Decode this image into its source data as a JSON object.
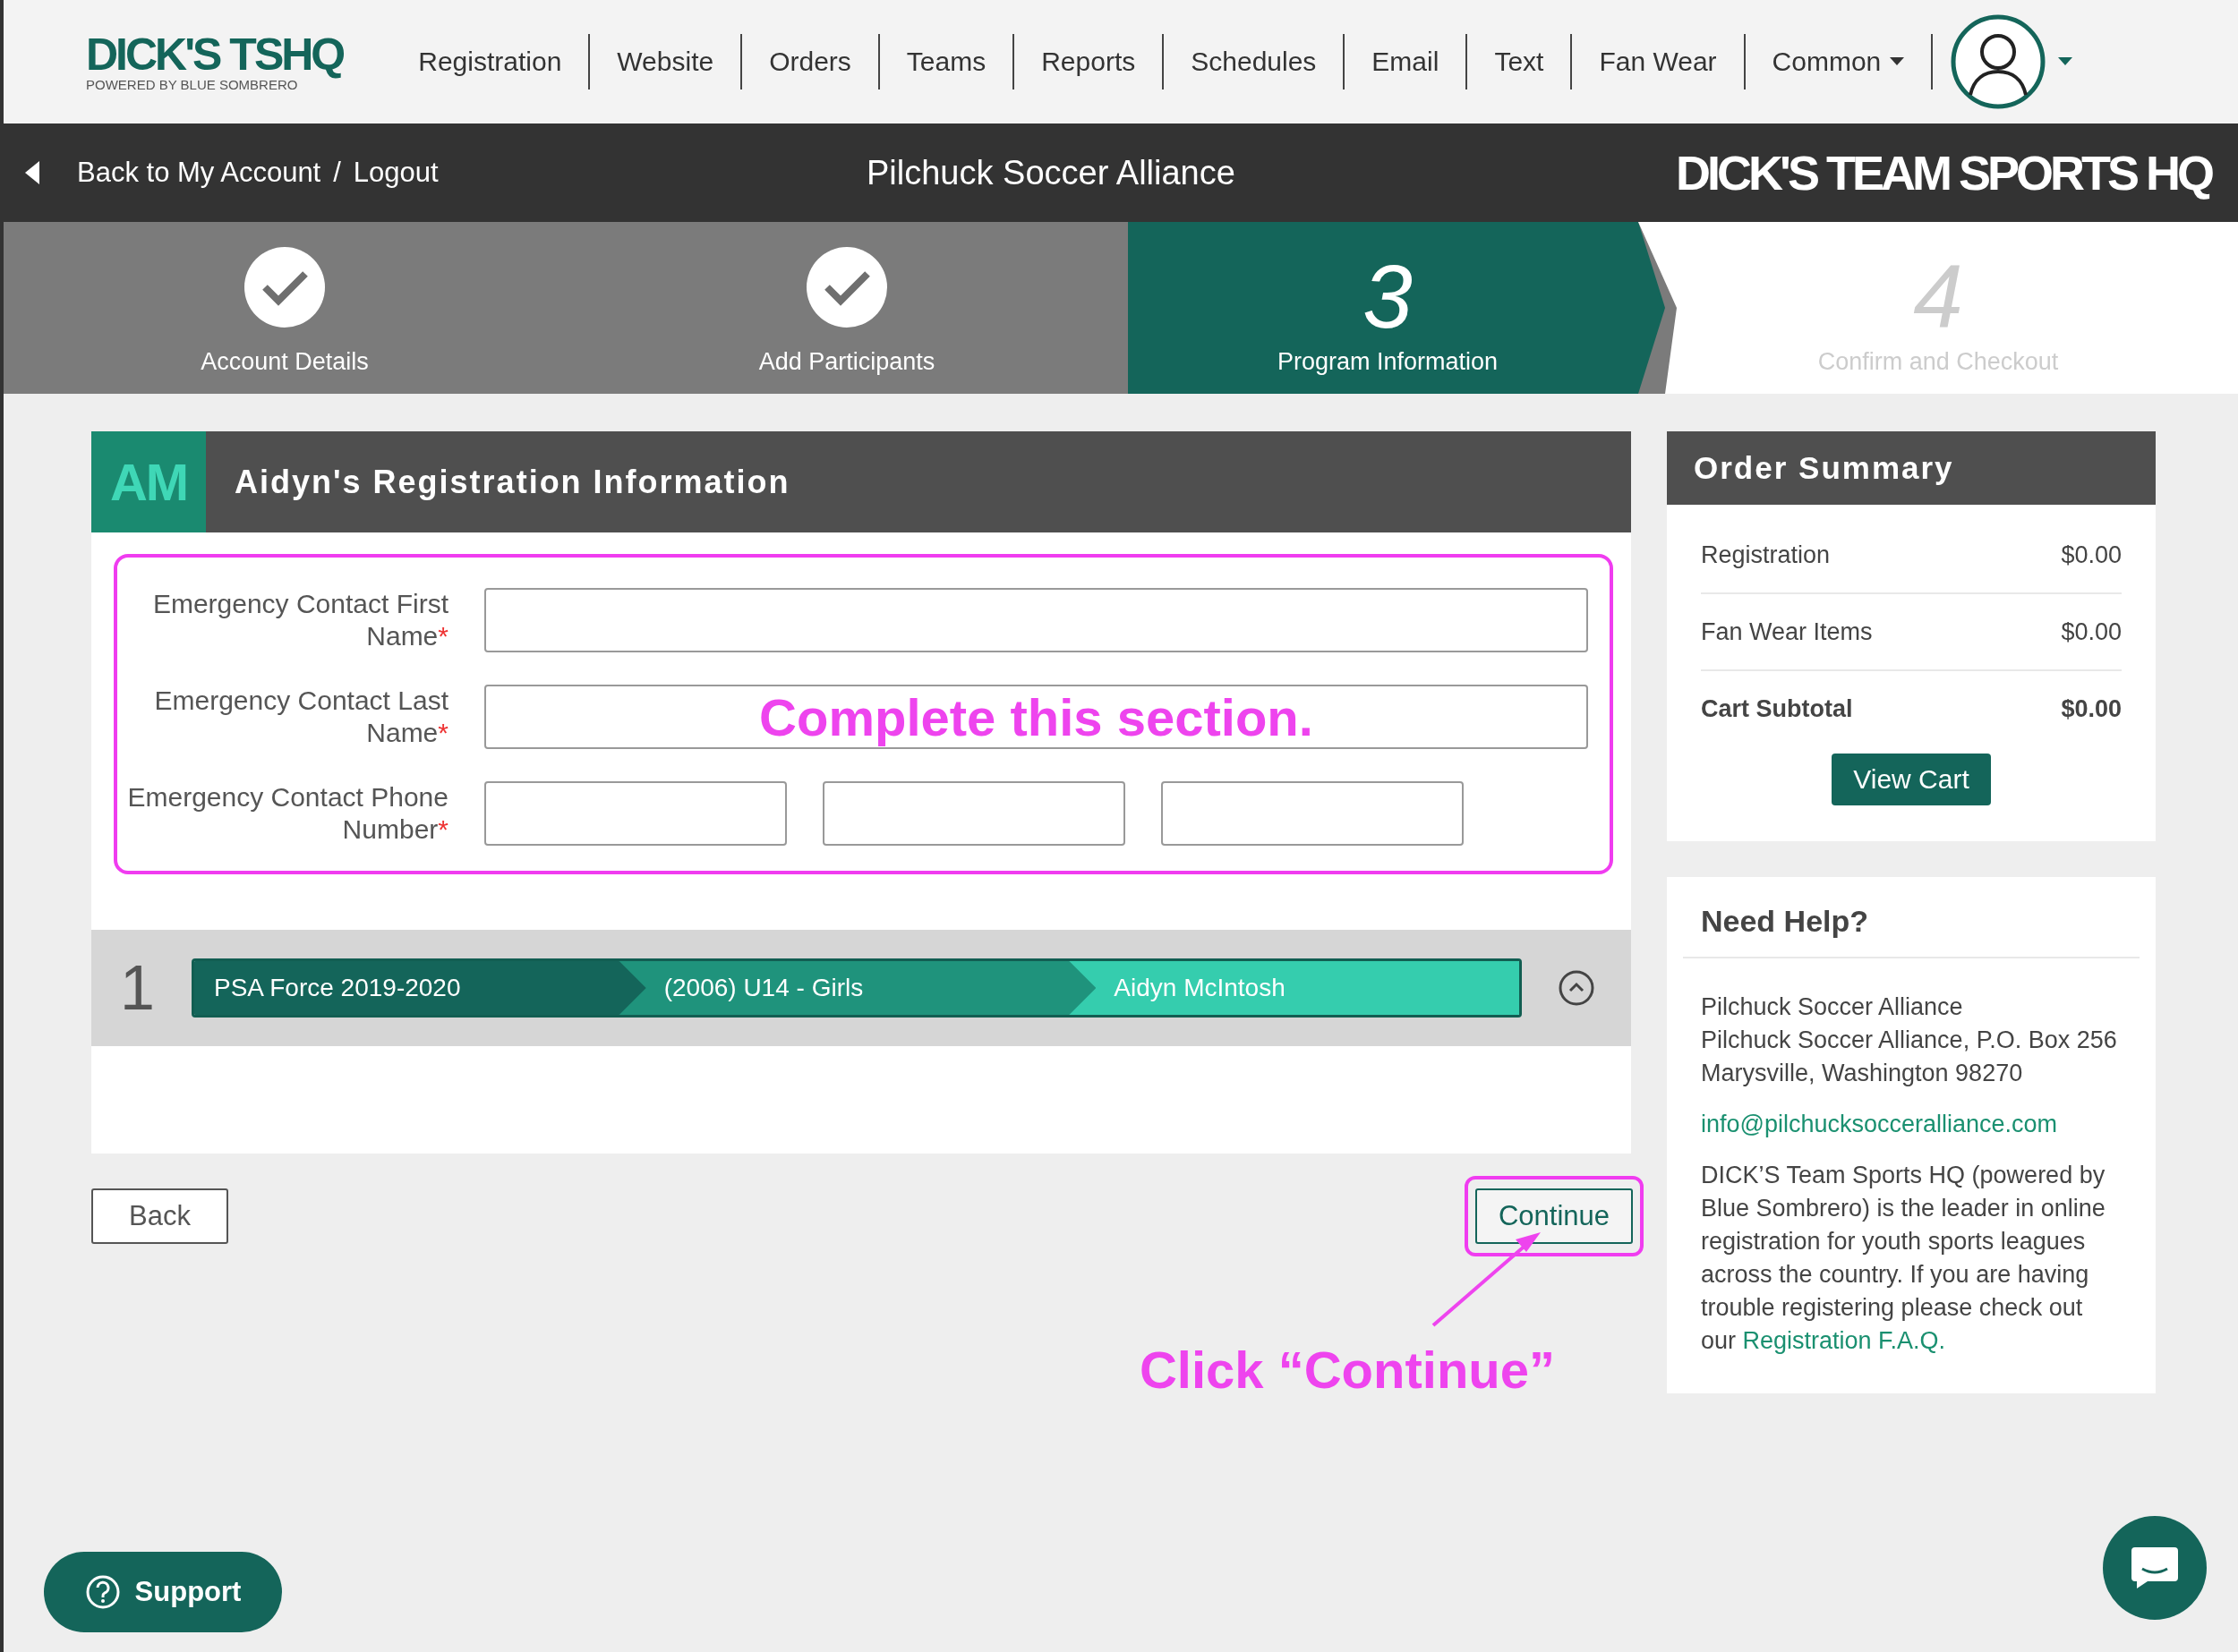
{
  "nav": {
    "logo_title": "DICK'S TSHQ",
    "logo_subtitle": "POWERED BY BLUE SOMBRERO",
    "items": [
      {
        "label": "Registration",
        "dropdown": false
      },
      {
        "label": "Website",
        "dropdown": false
      },
      {
        "label": "Orders",
        "dropdown": false
      },
      {
        "label": "Teams",
        "dropdown": false
      },
      {
        "label": "Reports",
        "dropdown": false
      },
      {
        "label": "Schedules",
        "dropdown": false
      },
      {
        "label": "Email",
        "dropdown": false
      },
      {
        "label": "Text",
        "dropdown": false
      },
      {
        "label": "Fan Wear",
        "dropdown": false
      },
      {
        "label": "Common",
        "dropdown": true
      }
    ]
  },
  "account_bar": {
    "back_link": "Back to My Account",
    "separator": "/",
    "logout_link": "Logout",
    "org_name": "Pilchuck Soccer Alliance",
    "brand": "DICK'S TEAM SPORTS HQ"
  },
  "steps": [
    {
      "label": "Account Details",
      "completed": true,
      "selected": false
    },
    {
      "label": "Add Participants",
      "completed": true,
      "selected": false
    },
    {
      "number": "3",
      "label": "Program Information",
      "completed": false,
      "selected": true
    },
    {
      "number": "4",
      "label": "Confirm and Checkout",
      "completed": false,
      "selected": false
    }
  ],
  "registration": {
    "initials": "AM",
    "title": "Aidyn's Registration Information",
    "fields": [
      {
        "label": "Emergency Contact First Name",
        "required_mark": "*",
        "kind": "text"
      },
      {
        "label": "Emergency Contact Last Name",
        "required_mark": "*",
        "kind": "text"
      },
      {
        "label": "Emergency Contact Phone Number",
        "required_mark": "*",
        "kind": "phone"
      }
    ],
    "participant": {
      "index": "1",
      "segments": [
        "PSA Force 2019-2020",
        "(2006) U14 - Girls",
        "Aidyn McIntosh"
      ]
    }
  },
  "buttons": {
    "back": "Back",
    "continue": "Continue"
  },
  "order_summary": {
    "title": "Order Summary",
    "lines": [
      {
        "label": "Registration",
        "amount": "$0.00",
        "total": false
      },
      {
        "label": "Fan Wear Items",
        "amount": "$0.00",
        "total": false
      },
      {
        "label": "Cart Subtotal",
        "amount": "$0.00",
        "total": true
      }
    ],
    "button": "View Cart"
  },
  "help": {
    "title": "Need Help?",
    "address_lines": [
      "Pilchuck Soccer Alliance",
      "Pilchuck Soccer Alliance, P.O. Box 256",
      "Marysville, Washington 98270"
    ],
    "email": "info@pilchucksocceralliance.com",
    "about": "DICK’S Team Sports HQ (powered by Blue Sombrero) is the leader in online registration for youth sports leagues across the country. If you are having trouble registering please check out our",
    "faq_link": "Registration F.A.Q."
  },
  "support": {
    "label": "Support"
  },
  "annotations": [
    {
      "text": "Complete this section."
    },
    {
      "text": "Click “Continue”"
    }
  ]
}
